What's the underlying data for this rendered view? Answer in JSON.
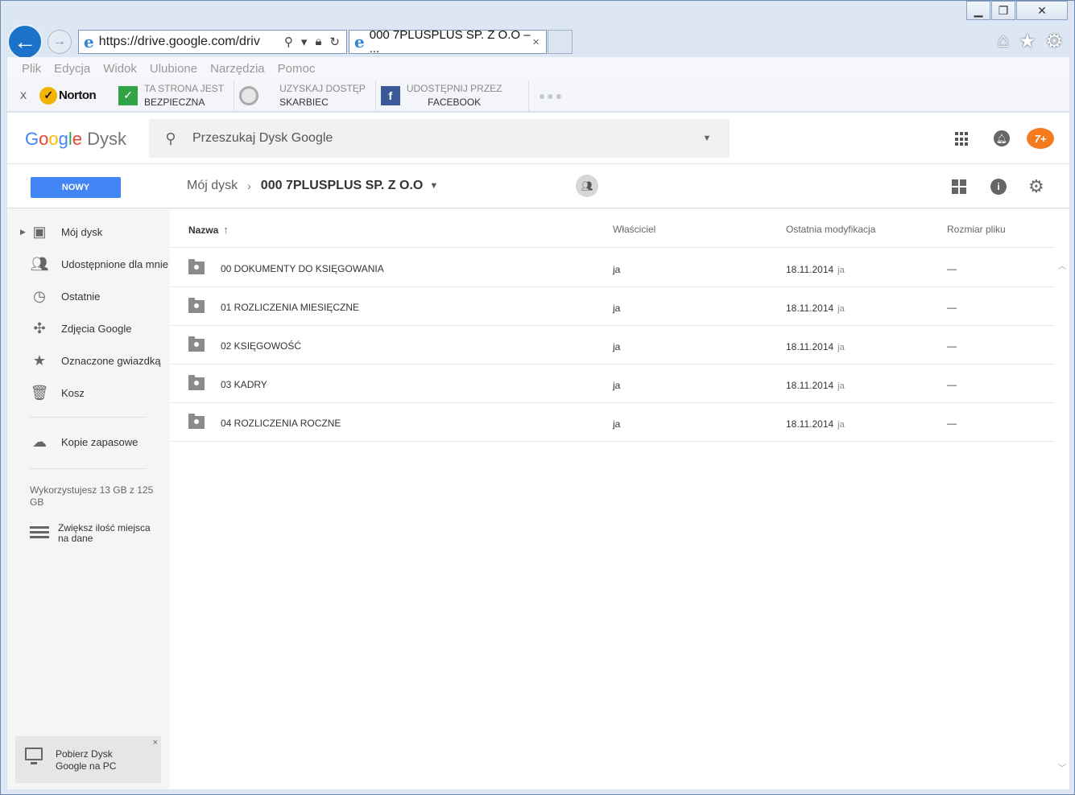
{
  "browser": {
    "address": "https://drive.google.com/driv",
    "tab_title": "000 7PLUSPLUS SP. Z O.O – ...",
    "tab_close": "×",
    "window_controls": [
      "minimize",
      "restore",
      "close"
    ],
    "menu": [
      "Plik",
      "Edycja",
      "Widok",
      "Ulubione",
      "Narzędzia",
      "Pomoc"
    ]
  },
  "norton_toolbar": {
    "close_label": "x",
    "brand": "Norton",
    "safe_line1": "TA STRONA JEST",
    "safe_line2": "BEZPIECZNA",
    "vault_line1": "UZYSKAJ DOSTĘP",
    "vault_line2": "SKARBIEC",
    "facebook_line1": "UDOSTĘPNIJ PRZEZ",
    "facebook_line2": "FACEBOOK",
    "more": "●●●"
  },
  "drive": {
    "logo_google": "Google",
    "logo_product": "Dysk",
    "search_placeholder": "Przeszukaj Dysk Google",
    "new_button": "NOWY",
    "breadcrumb_root": "Mój dysk",
    "breadcrumb_current": "000 7PLUSPLUS SP. Z O.O",
    "sidebar": {
      "items": [
        {
          "label": "Mój dysk",
          "icon": "drive-icon"
        },
        {
          "label": "Udostępnione dla mnie",
          "icon": "people-icon"
        },
        {
          "label": "Ostatnie",
          "icon": "clock-icon"
        },
        {
          "label": "Zdjęcia Google",
          "icon": "photos-icon"
        },
        {
          "label": "Oznaczone gwiazdką",
          "icon": "star-icon"
        },
        {
          "label": "Kosz",
          "icon": "trash-icon"
        }
      ],
      "backup_label": "Kopie zapasowe",
      "storage_text": "Wykorzystujesz 13 GB z 125 GB",
      "upgrade_label": "Zwiększ ilość miejsca na dane",
      "download_card_text": "Pobierz Dysk Google na PC",
      "download_card_close": "×"
    },
    "columns": {
      "name": "Nazwa",
      "owner": "Właściciel",
      "modified": "Ostatnia modyfikacja",
      "size": "Rozmiar pliku"
    },
    "files": [
      {
        "name": "00 DOKUMENTY DO KSIĘGOWANIA",
        "owner": "ja",
        "date": "18.11.2014",
        "by": "ja",
        "size": "—"
      },
      {
        "name": "01 ROZLICZENIA MIESIĘCZNE",
        "owner": "ja",
        "date": "18.11.2014",
        "by": "ja",
        "size": "—"
      },
      {
        "name": "02 KSIĘGOWOŚĆ",
        "owner": "ja",
        "date": "18.11.2014",
        "by": "ja",
        "size": "—"
      },
      {
        "name": "03 KADRY",
        "owner": "ja",
        "date": "18.11.2014",
        "by": "ja",
        "size": "—"
      },
      {
        "name": "04 ROZLICZENIA ROCZNE",
        "owner": "ja",
        "date": "18.11.2014",
        "by": "ja",
        "size": "—"
      }
    ]
  },
  "colors": {
    "new_button": "#4285f4",
    "ie_back": "#1a73c8",
    "avatar": "#f47a20"
  }
}
